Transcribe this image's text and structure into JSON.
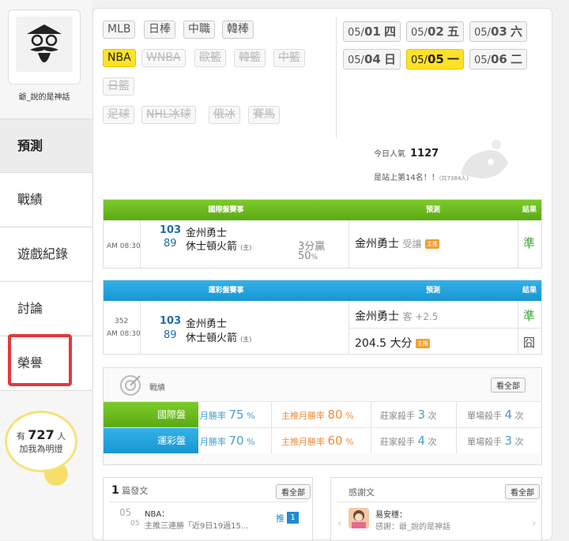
{
  "profile": {
    "username": "爺_說的是神話"
  },
  "nav": [
    "預測",
    "戰績",
    "遊戲紀錄",
    "討論",
    "榮譽"
  ],
  "fans": {
    "prefix": "有",
    "count": "727",
    "unit": "人",
    "line2": "加我為明燈"
  },
  "sports_row1": [
    "MLB",
    "日棒",
    "中職",
    "韓棒"
  ],
  "sports_row2": [
    "NBA",
    "WNBA",
    "歐籃",
    "韓籃",
    "中籃"
  ],
  "sports_row3": [
    "日籃"
  ],
  "sports_row4": [
    "足球",
    "NHL冰球",
    "俄冰",
    "賽馬"
  ],
  "dates": [
    {
      "md": "05/",
      "d": "01",
      "w": "四"
    },
    {
      "md": "05/",
      "d": "02",
      "w": "五"
    },
    {
      "md": "05/",
      "d": "03",
      "w": "六"
    },
    {
      "md": "05/",
      "d": "04",
      "w": "日"
    },
    {
      "md": "05/",
      "d": "05",
      "w": "一"
    },
    {
      "md": "05/",
      "d": "06",
      "w": "二"
    }
  ],
  "popularity": {
    "label": "今日人氣",
    "value": "1127",
    "rank_text": "是站上第14名！！",
    "rank_total": "(共7384人)"
  },
  "intl_table": {
    "headers": [
      "國際盤賽事",
      "預測",
      "結果"
    ],
    "time": "AM 08:30",
    "home_no": "103",
    "home_team": "金州勇士",
    "away_no": "89",
    "away_team": "休士頓火箭",
    "away_tag": "(主)",
    "spread": "3分贏",
    "pct": "50",
    "pct_unit": "%",
    "pick_team": "金州勇士",
    "pick_detail": "受讓",
    "pick_badge": "主推",
    "result": "準"
  },
  "lottery_table": {
    "headers": [
      "運彩盤賽事",
      "預測",
      "結果"
    ],
    "game_no": "352",
    "time": "AM 08:30",
    "home_no": "103",
    "home_team": "金州勇士",
    "away_no": "89",
    "away_team": "休士頓火箭",
    "away_tag": "(主)",
    "pick1_team": "金州勇士",
    "pick1_detail": "客 +2.5",
    "result1": "準",
    "pick2": "204.5 大分",
    "pick2_badge": "主推",
    "result2": "囧"
  },
  "stats": {
    "title": "戰績",
    "view_all": "看全部",
    "rows": [
      {
        "label": "國際盤",
        "month_label": "月勝率",
        "month": "75",
        "pct": "%",
        "main_label": "主推月勝率",
        "main": "80",
        "pct2": "%",
        "bank_label": "莊家殺手",
        "bank": "3",
        "unit": "次",
        "single_label": "單場殺手",
        "single": "4",
        "unit2": "次"
      },
      {
        "label": "運彩盤",
        "month_label": "月勝率",
        "month": "70",
        "pct": "%",
        "main_label": "主推月勝率",
        "main": "60",
        "pct2": "%",
        "bank_label": "莊家殺手",
        "bank": "4",
        "unit": "次",
        "single_label": "單場殺手",
        "single": "3",
        "unit2": "次"
      }
    ]
  },
  "posts": {
    "count": "1",
    "title": "篇發文",
    "view_all": "看全部",
    "date_top": "05",
    "date_bottom": "05",
    "line1": "NBA：",
    "line2": "主推三連勝「近9日19過15...",
    "push_label": "推",
    "push_count": "1"
  },
  "thanks": {
    "title": "感謝文",
    "view_all": "看全部",
    "name": "易安穩：",
    "text": "感謝：爺_說的是神話"
  }
}
